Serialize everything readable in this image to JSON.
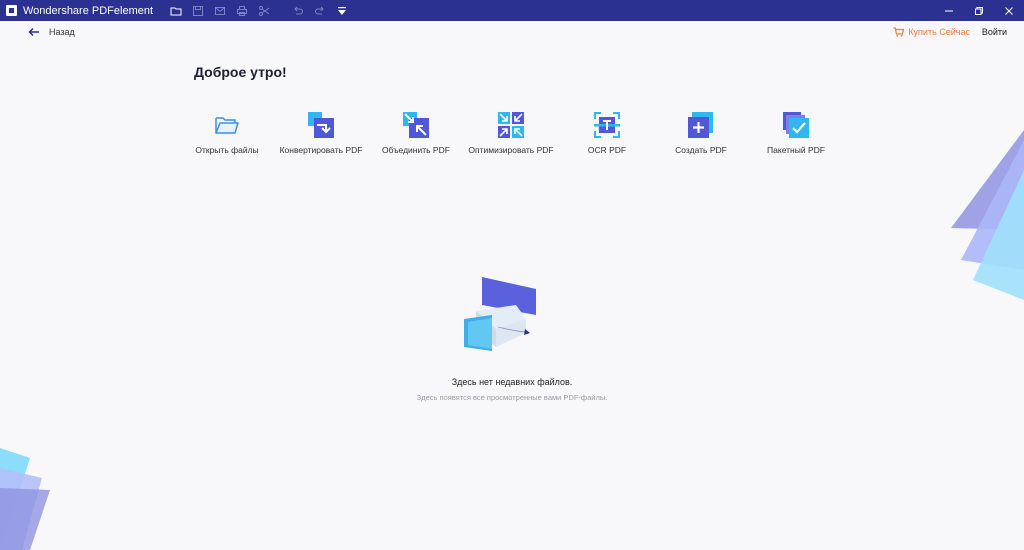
{
  "titlebar": {
    "app_title": "Wondershare PDFelement",
    "icons": [
      "folder-icon",
      "save-icon",
      "mail-icon",
      "print-icon",
      "scissors-icon",
      "undo-icon",
      "redo-icon",
      "dropdown-icon"
    ],
    "window_controls": [
      "minimize-icon",
      "restore-icon",
      "close-icon"
    ]
  },
  "header": {
    "back_label": "Назад",
    "buy_label": "Купить Сейчас",
    "login_label": "Войти"
  },
  "greeting": "Доброе утро!",
  "tools": [
    {
      "label": "Открыть файлы",
      "icon": "open-folder-icon"
    },
    {
      "label": "Конвертировать PDF",
      "icon": "convert-icon"
    },
    {
      "label": "Объединить PDF",
      "icon": "combine-icon"
    },
    {
      "label": "Оптимизировать PDF",
      "icon": "optimize-icon"
    },
    {
      "label": "OCR PDF",
      "icon": "ocr-icon"
    },
    {
      "label": "Создать PDF",
      "icon": "create-icon"
    },
    {
      "label": "Пакетный PDF",
      "icon": "batch-icon"
    }
  ],
  "empty_state": {
    "title": "Здесь нет недавних файлов.",
    "subtitle": "Здесь появятся все просмотренные вами PDF-файлы."
  },
  "colors": {
    "titlebar": "#2b3191",
    "accent": "#f07c3d",
    "background": "#f8f8fb"
  }
}
